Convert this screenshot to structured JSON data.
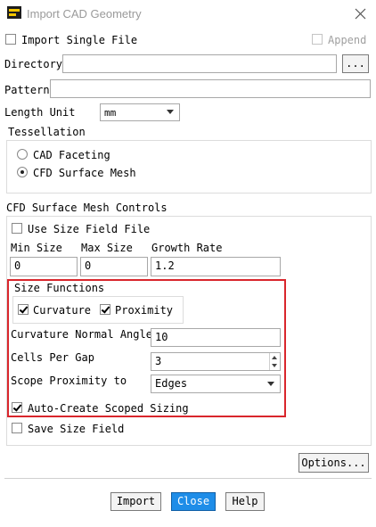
{
  "window": {
    "title": "Import CAD Geometry",
    "app_icon": "ansys-fluent-icon",
    "close_icon": "close-icon"
  },
  "import_single_file": {
    "label": "Import Single File",
    "checked": false
  },
  "append": {
    "label": "Append",
    "checked": false,
    "disabled": true
  },
  "directory": {
    "label": "Directory",
    "value": "",
    "browse_label": "..."
  },
  "pattern": {
    "label": "Pattern",
    "value": ""
  },
  "length_unit": {
    "label": "Length Unit",
    "value": "mm"
  },
  "tessellation": {
    "title": "Tessellation",
    "options": [
      {
        "label": "CAD Faceting",
        "selected": false
      },
      {
        "label": "CFD Surface Mesh",
        "selected": true
      }
    ]
  },
  "cfd_controls": {
    "title": "CFD Surface Mesh Controls",
    "use_size_field_file": {
      "label": "Use Size Field File",
      "checked": false
    },
    "min_size": {
      "label": "Min Size",
      "value": "0"
    },
    "max_size": {
      "label": "Max Size",
      "value": "0"
    },
    "growth_rate": {
      "label": "Growth Rate",
      "value": "1.2"
    },
    "size_functions": {
      "title": "Size Functions",
      "curvature": {
        "label": "Curvature",
        "checked": true
      },
      "proximity": {
        "label": "Proximity",
        "checked": true
      }
    },
    "curvature_normal_angle": {
      "label": "Curvature Normal Angle",
      "value": "10"
    },
    "cells_per_gap": {
      "label": "Cells Per Gap",
      "value": "3"
    },
    "scope_proximity_to": {
      "label": "Scope Proximity to",
      "value": "Edges"
    },
    "auto_create_scoped_sizing": {
      "label": "Auto-Create Scoped Sizing",
      "checked": true
    },
    "highlight_color": "#d9262c"
  },
  "save_size_field": {
    "label": "Save Size Field",
    "checked": false
  },
  "buttons": {
    "options": "Options...",
    "import": "Import",
    "close": "Close",
    "help": "Help"
  },
  "colors": {
    "primary_button": "#1e8de8"
  }
}
